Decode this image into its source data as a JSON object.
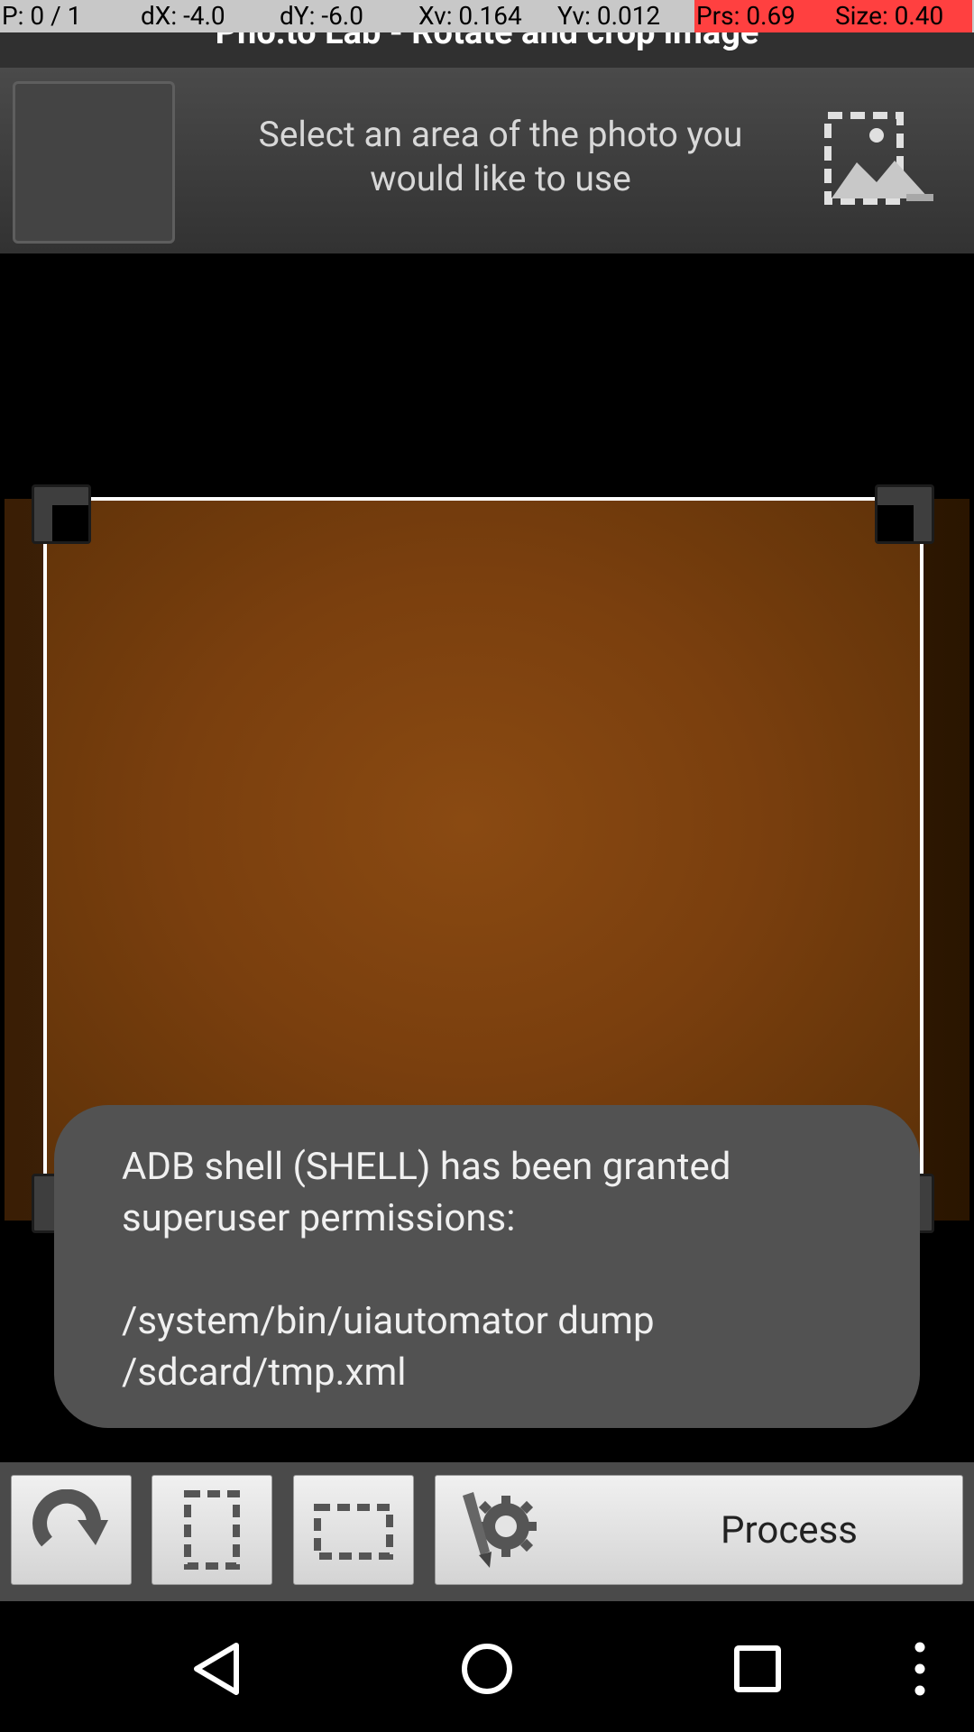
{
  "debug": {
    "p": "P: 0 / 1",
    "dx": "dX: -4.0",
    "dy": "dY: -6.0",
    "xv": "Xv: 0.164",
    "yv": "Yv: 0.012",
    "prs": "Prs: 0.69",
    "size": "Size: 0.40"
  },
  "title": "Pho.to Lab - Rotate and crop image",
  "header": {
    "instruction": "Select an area of the photo you would like to use",
    "gallery_icon": "image-gallery-icon"
  },
  "toast": {
    "line1": "ADB shell (SHELL) has been granted superuser permissions:",
    "line2": "/system/bin/uiautomator dump /sdcard/tmp.xml"
  },
  "toolbar": {
    "rotate_icon": "rotate-icon",
    "portrait_icon": "crop-portrait-icon",
    "landscape_icon": "crop-landscape-icon",
    "settings_icon": "brush-gear-icon",
    "process_label": "Process"
  },
  "navbar": {
    "back_icon": "back-icon",
    "home_icon": "home-icon",
    "recents_icon": "recents-icon",
    "menu_icon": "overflow-menu-icon"
  },
  "colors": {
    "photo_orange": "#7a3f0e",
    "toast_bg": "#525252",
    "debug_red": "#ff4040"
  }
}
